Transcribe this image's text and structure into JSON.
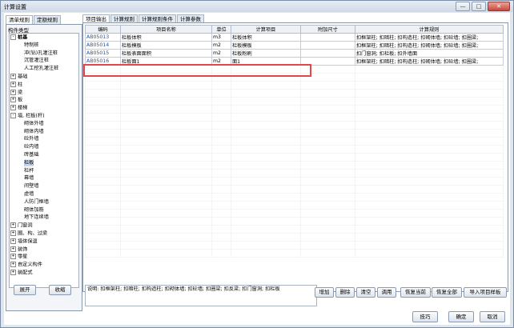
{
  "window": {
    "title": "计算设置",
    "min": "—",
    "max": "□",
    "close": "✕"
  },
  "left_tabs": [
    "清单规则",
    "定额规则"
  ],
  "left_panel_title": "构件类型",
  "tree": [
    {
      "label": "桩基",
      "level": 0,
      "toggle": "-",
      "bold": true
    },
    {
      "label": "特制桩",
      "level": 1
    },
    {
      "label": "冲(钻)孔灌注桩",
      "level": 1
    },
    {
      "label": "沉管灌注桩",
      "level": 1
    },
    {
      "label": "人工挖孔灌注桩",
      "level": 1
    },
    {
      "label": "基础",
      "level": 0,
      "toggle": "+"
    },
    {
      "label": "柱",
      "level": 0,
      "toggle": "+"
    },
    {
      "label": "梁",
      "level": 0,
      "toggle": "+"
    },
    {
      "label": "板",
      "level": 0,
      "toggle": "+"
    },
    {
      "label": "楼梯",
      "level": 0,
      "toggle": "+"
    },
    {
      "label": "墙, 栏板(杆)",
      "level": 0,
      "toggle": "-"
    },
    {
      "label": "砌体外墙",
      "level": 1
    },
    {
      "label": "砌体内墙",
      "level": 1
    },
    {
      "label": "砼外墙",
      "level": 1
    },
    {
      "label": "砼内墙",
      "level": 1
    },
    {
      "label": "砖基础",
      "level": 1
    },
    {
      "label": "栏板",
      "level": 1,
      "selected": true
    },
    {
      "label": "栏杆",
      "level": 1
    },
    {
      "label": "幕墙",
      "level": 1
    },
    {
      "label": "间壁墙",
      "level": 1
    },
    {
      "label": "虚墙",
      "level": 1
    },
    {
      "label": "人防门框墙",
      "level": 1
    },
    {
      "label": "砌体加筋",
      "level": 1
    },
    {
      "label": "地下连续墙",
      "level": 1
    },
    {
      "label": "门窗洞",
      "level": 0,
      "toggle": "+"
    },
    {
      "label": "圈、构、过梁",
      "level": 0,
      "toggle": "+"
    },
    {
      "label": "墙体保温",
      "level": 0,
      "toggle": "+"
    },
    {
      "label": "装饰",
      "level": 0,
      "toggle": "+"
    },
    {
      "label": "零星",
      "level": 0,
      "toggle": "+"
    },
    {
      "label": "自定义构件",
      "level": 0,
      "toggle": "+"
    },
    {
      "label": "装配式",
      "level": 0,
      "toggle": "+"
    }
  ],
  "left_buttons": {
    "expand": "展开",
    "collapse": "收缩"
  },
  "right_tabs": [
    "项目输出",
    "计算规则",
    "计算规则条件",
    "计算参数"
  ],
  "table": {
    "headers": [
      "编码",
      "项目名称",
      "单位",
      "计算项目",
      "附加尺寸",
      "计算规则"
    ],
    "rows": [
      [
        "AB05013",
        "栏板体积",
        "m3",
        "栏板体积",
        "",
        "扣框架柱; 扣暗柱; 扣构造柱; 扣砌体墙; 扣砼墙; 扣圈梁;"
      ],
      [
        "AB05014",
        "栏板模板",
        "m2",
        "栏板模板",
        "",
        "扣框架柱; 扣暗柱; 扣构造柱; 扣砌体墙; 扣砼墙; 扣圈梁;"
      ],
      [
        "AB05015",
        "栏板表面面积",
        "m2",
        "栏板粉刷",
        "",
        "扣门窗洞; 扣栏板; 扣外墙面"
      ],
      [
        "AB05016",
        "栏板面1",
        "m2",
        "面1",
        "",
        "扣框架柱; 扣暗柱; 扣构造柱; 扣砌体墙; 扣砼墙; 扣圈梁;"
      ]
    ]
  },
  "description": "说明: 扣框架柱; 扣暗柱; 扣构造柱; 扣砌体墙; 扣砼墙; 扣圈梁; 扣反梁; 扣门窗洞; 扣栏板",
  "action_buttons": [
    "增加",
    "删除",
    "清空",
    "调用",
    "恢复当前",
    "恢复全部",
    "导入项目样板"
  ],
  "bottom_buttons": {
    "tips": "技巧",
    "ok": "确定",
    "cancel": "取消"
  }
}
